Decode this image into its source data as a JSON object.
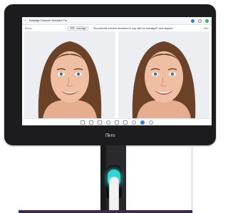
{
  "device": {
    "brand": "iTero"
  },
  "app": {
    "window_title": "Invisalign Outcome Simulator Pro",
    "before_label": "Before",
    "after_label": "After",
    "toggle_label": "Invisalign",
    "disclaimer": "This potential outcome simulation is only valid for Invisalign® clear aligners",
    "icons": [
      "back-icon",
      "info-icon",
      "gear-icon",
      "share-icon"
    ]
  },
  "toolbar": {
    "tools": [
      "rotate-icon",
      "compare-icon",
      "split-icon",
      "zoom-icon",
      "pan-icon",
      "crop-icon",
      "settings-icon",
      "color-icon",
      "record-icon"
    ]
  },
  "colors": {
    "accent": "#2b7de9",
    "glow": "#2fd6d2",
    "bezel": "#1c1c1e"
  }
}
